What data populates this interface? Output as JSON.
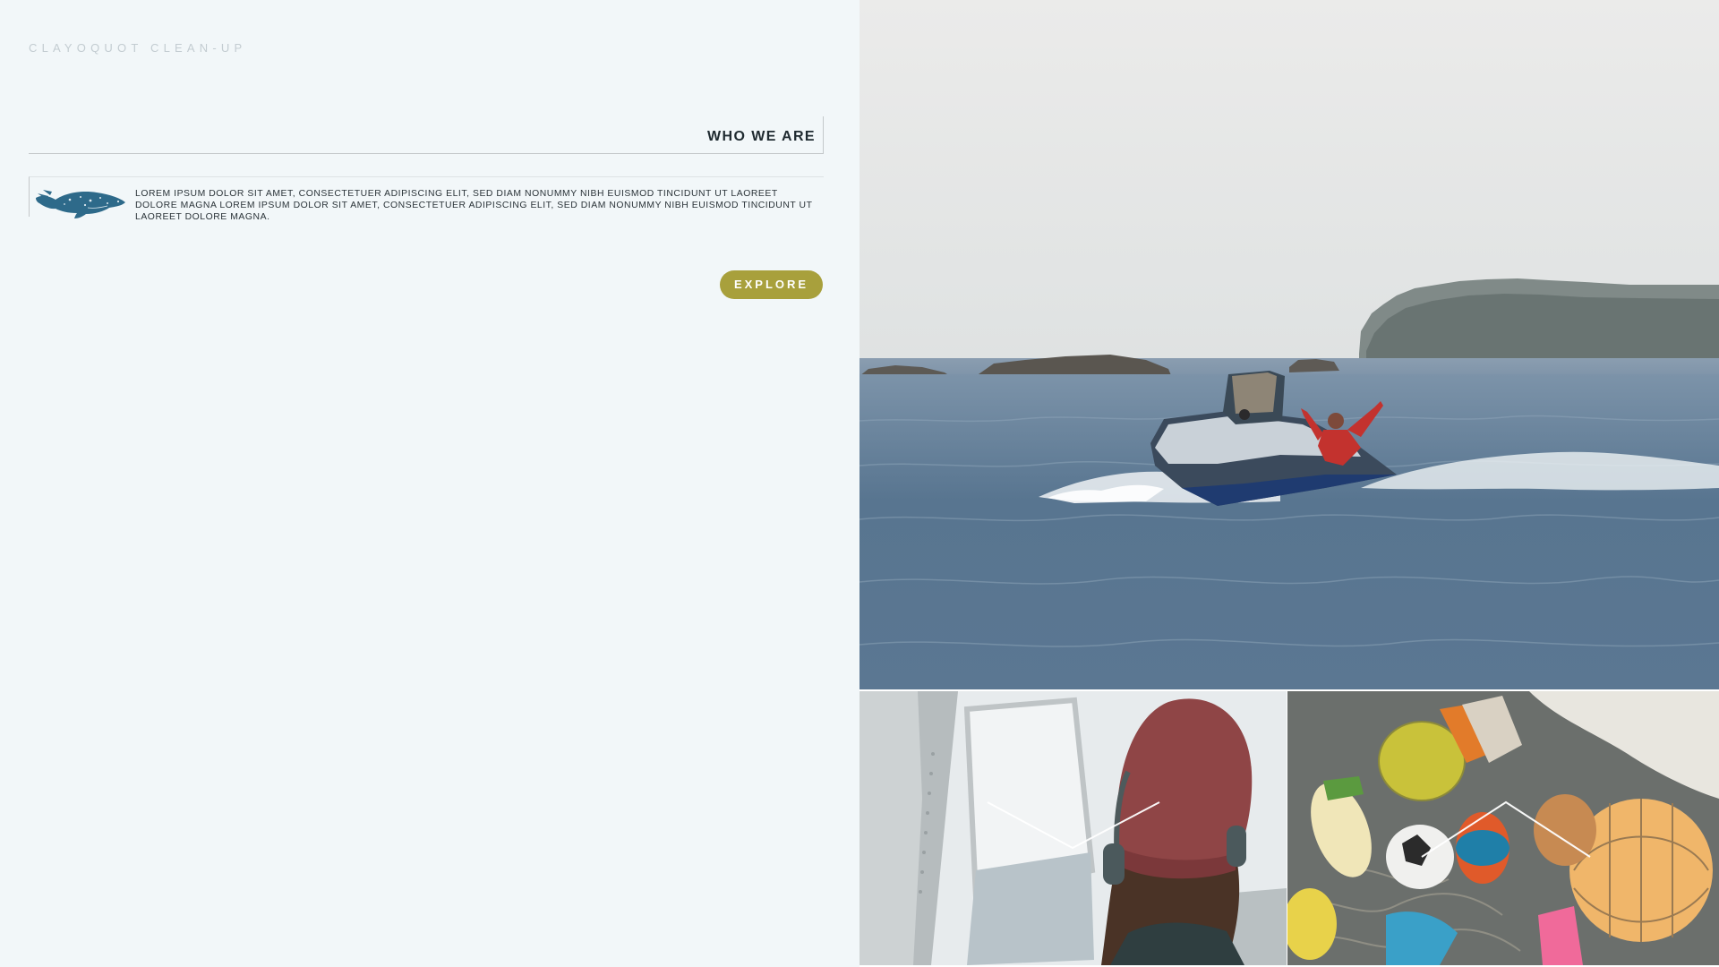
{
  "brand": {
    "name": "CLAYOQUOT CLEAN-UP"
  },
  "section": {
    "heading": "WHO WE ARE",
    "intro_text": "LOREM IPSUM DOLOR SIT AMET, CONSECTETUER ADIPISCING ELIT, SED DIAM NONUMMY NIBH EUISMOD TINCIDUNT UT LAOREET DOLORE MAGNA LOREM IPSUM DOLOR SIT AMET, CONSECTETUER ADIPISCING ELIT, SED DIAM NONUMMY NIBH EUISMOD TINCIDUNT UT LAOREET DOLORE MAGNA.",
    "icon": "whale-icon"
  },
  "cta": {
    "label": "EXPLORE"
  },
  "gallery": {
    "photos": [
      "boat-photo",
      "helicopter-passenger-photo",
      "buoys-photo"
    ],
    "overlay_icons": [
      "chevron-down-icon",
      "chevron-up-icon"
    ]
  },
  "colors": {
    "panel_bg": "#f2f7f9",
    "accent": "#a8a03c",
    "whale": "#2e6a8a",
    "brand_text": "#c3ccd1"
  }
}
